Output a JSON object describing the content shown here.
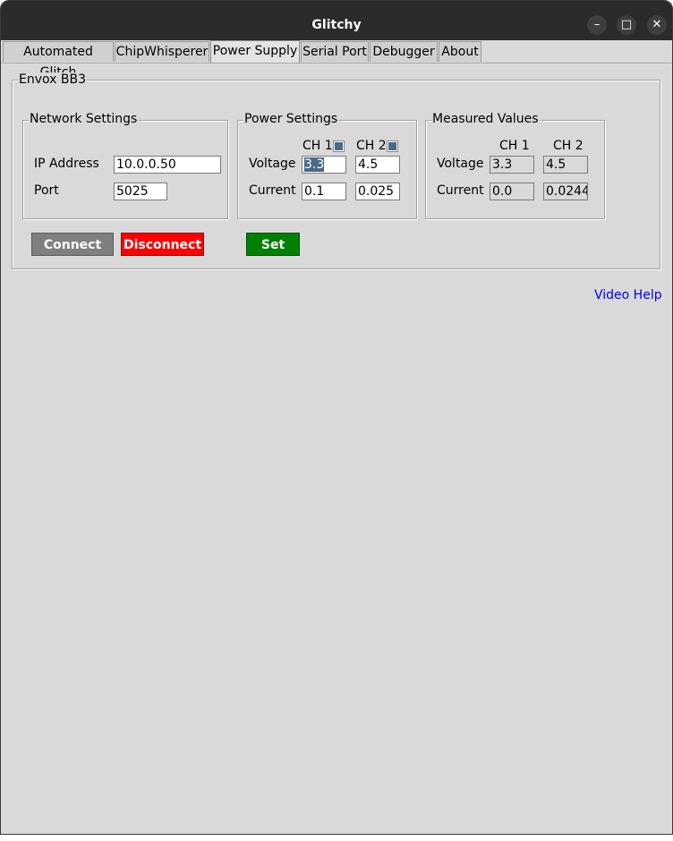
{
  "window": {
    "title": "Glitchy",
    "minimize_icon": "–",
    "maximize_icon": "□",
    "close_icon": "✕"
  },
  "tabs": [
    {
      "label": "Automated Glitch"
    },
    {
      "label": "ChipWhisperer"
    },
    {
      "label": "Power Supply",
      "active": true
    },
    {
      "label": "Serial Port"
    },
    {
      "label": "Debugger"
    },
    {
      "label": "About"
    }
  ],
  "device": {
    "title": "Envox BB3",
    "network": {
      "title": "Network Settings",
      "ip_label": "IP Address",
      "ip_value": "10.0.0.50",
      "port_label": "Port",
      "port_value": "5025"
    },
    "power": {
      "title": "Power Settings",
      "ch1_label": "CH 1",
      "ch2_label": "CH 2",
      "ch1_enabled": true,
      "ch2_enabled": true,
      "voltage_label": "Voltage",
      "current_label": "Current",
      "ch1_voltage": "3.3",
      "ch2_voltage": "4.5",
      "ch1_current": "0.1",
      "ch2_current": "0.025"
    },
    "measured": {
      "title": "Measured Values",
      "ch1_label": "CH 1",
      "ch2_label": "CH 2",
      "voltage_label": "Voltage",
      "current_label": "Current",
      "ch1_voltage": "3.3",
      "ch2_voltage": "4.5",
      "ch1_current": "0.0",
      "ch2_current": "0.0244("
    },
    "buttons": {
      "connect": "Connect",
      "disconnect": "Disconnect",
      "set": "Set"
    }
  },
  "video_help": "Video Help",
  "colors": {
    "connect_bg": "#7f7f7f",
    "disconnect_bg": "#ff0000",
    "set_bg": "#008000",
    "link": "#0000ee"
  }
}
